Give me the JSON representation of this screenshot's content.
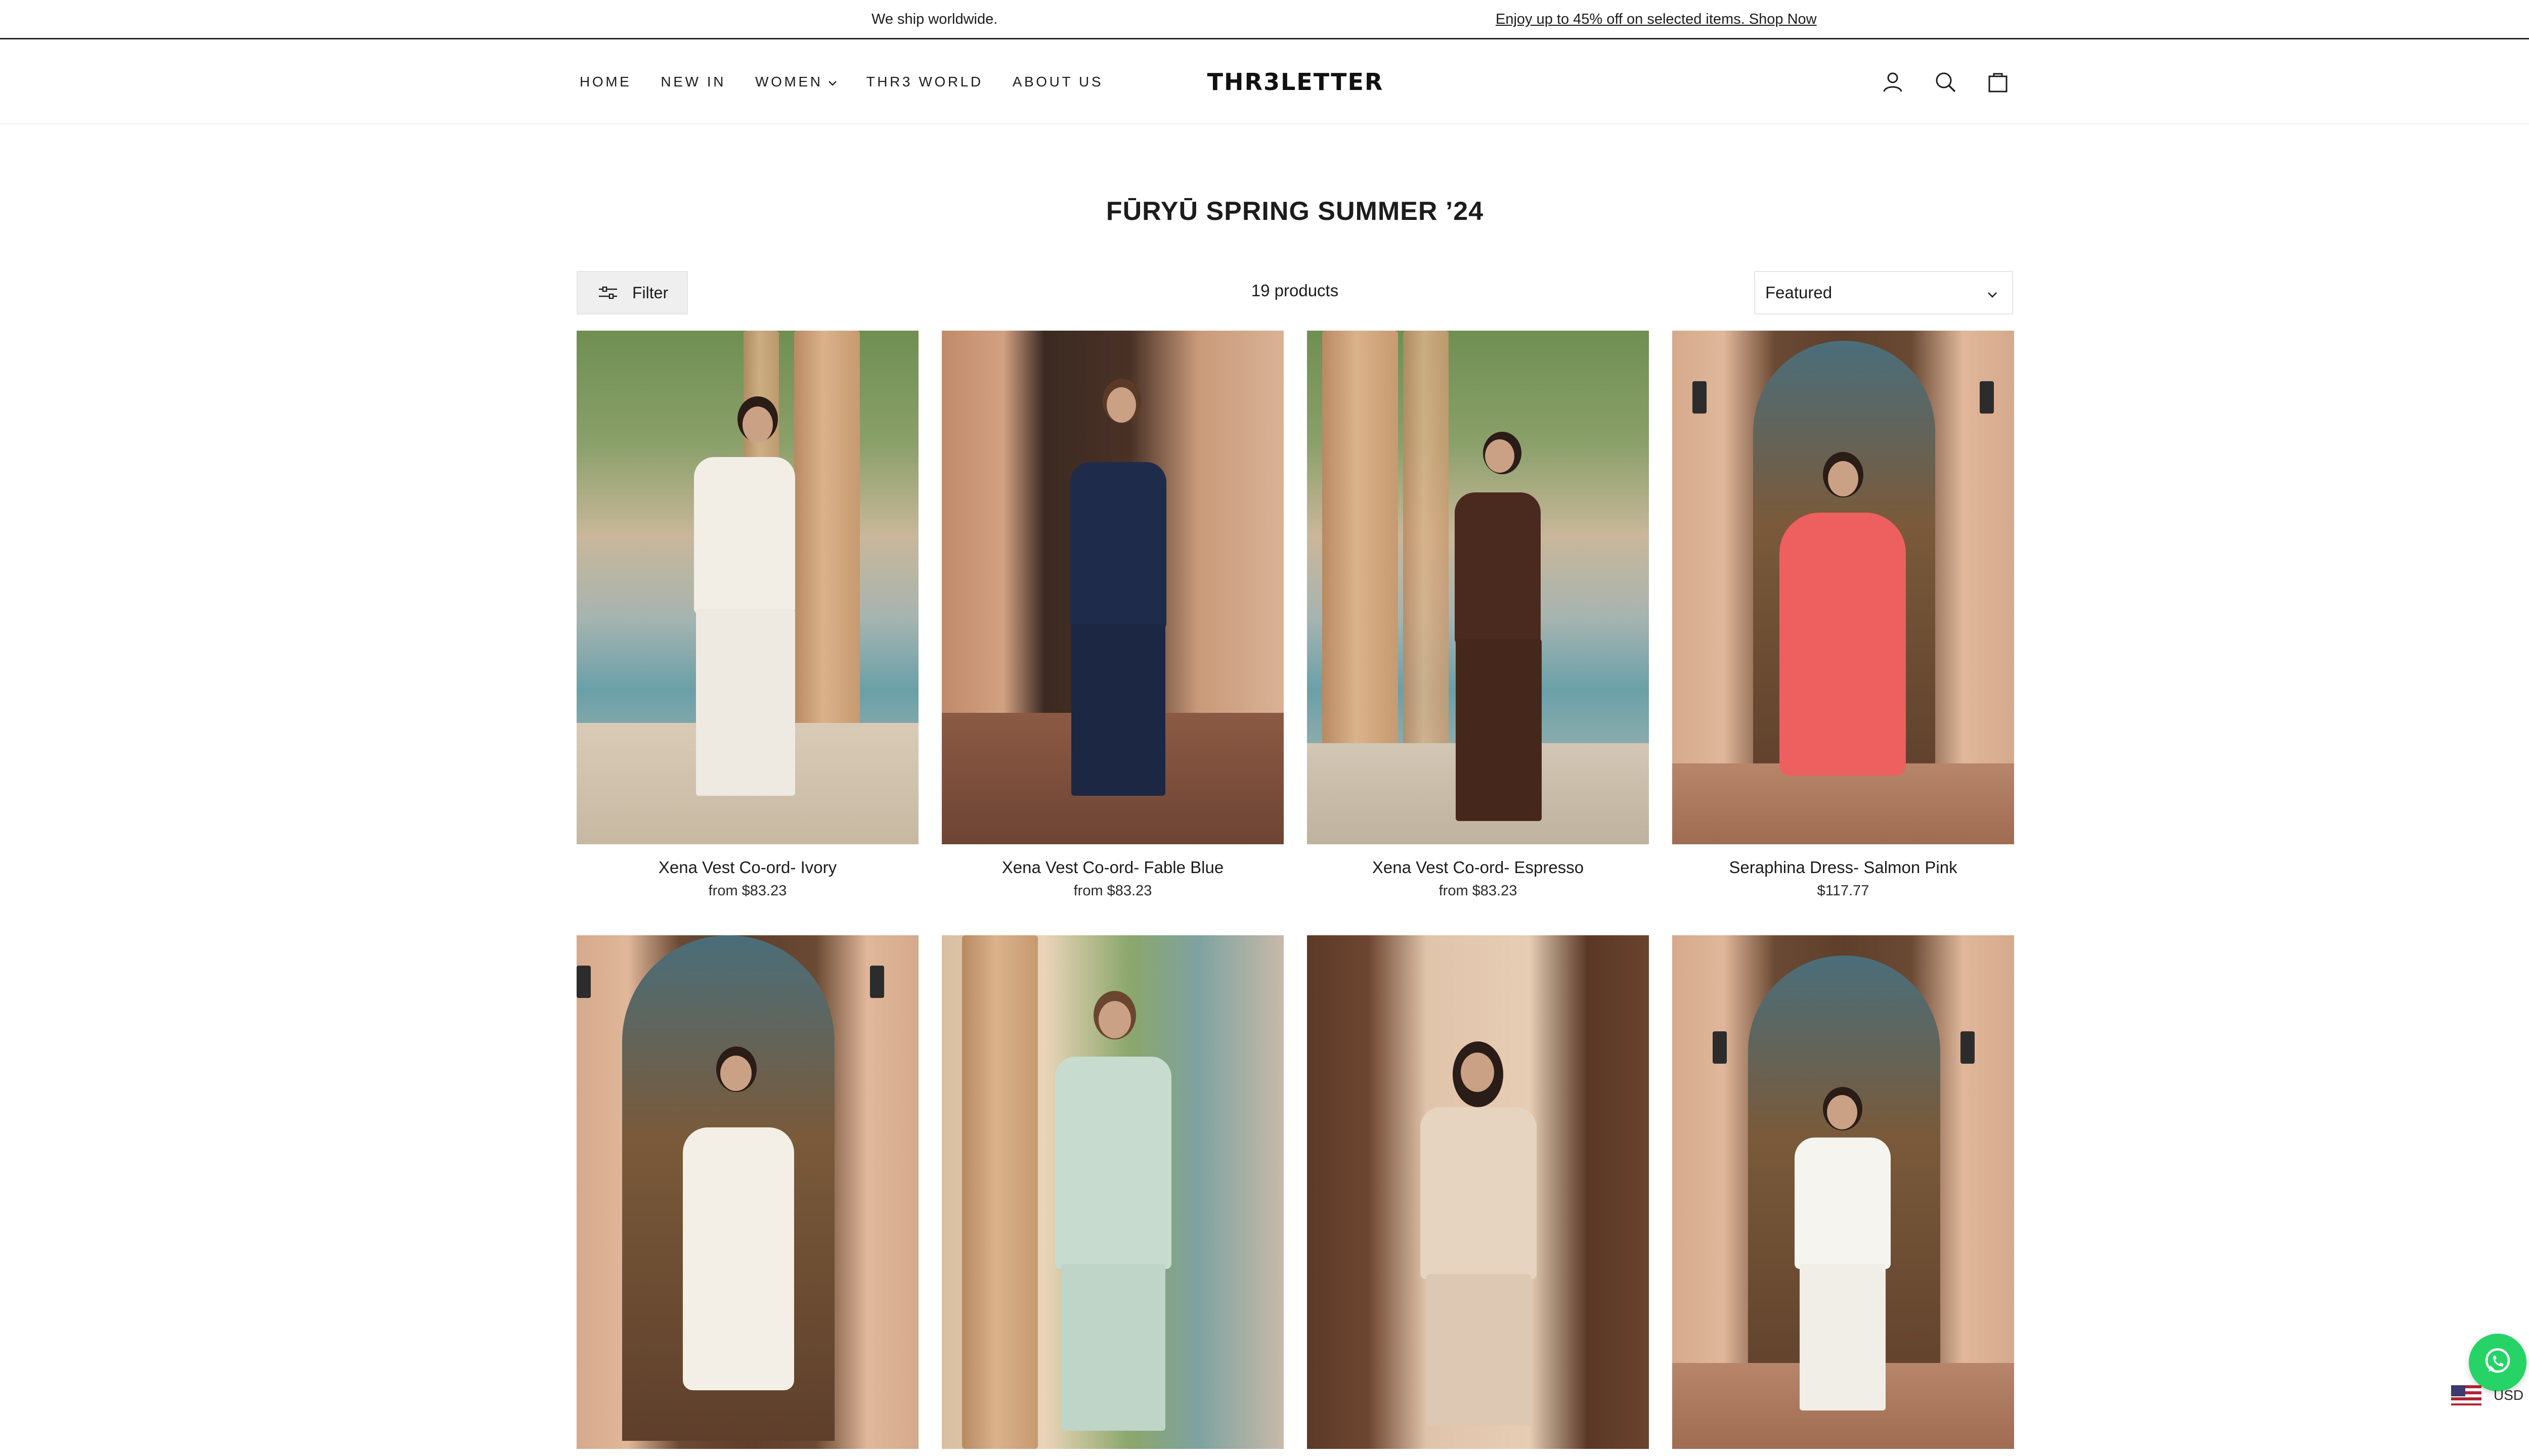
{
  "announcement": {
    "left": "We ship worldwide.",
    "right": "Enjoy up to 45% off on selected items. Shop Now"
  },
  "nav": {
    "items": [
      {
        "label": "HOME"
      },
      {
        "label": "NEW IN"
      },
      {
        "label": "WOMEN",
        "has_dropdown": true
      },
      {
        "label": "THR3 WORLD"
      },
      {
        "label": "ABOUT US"
      }
    ]
  },
  "brand": {
    "logo_text": "THR3LETTER"
  },
  "header_icons": [
    "account-icon",
    "search-icon",
    "cart-icon"
  ],
  "collection": {
    "title": "FŪRYŪ SPRING SUMMER ’24",
    "product_count": "19 products",
    "filter_label": "Filter",
    "sort_selected": "Featured"
  },
  "products": [
    {
      "name": "Xena Vest Co-ord- Ivory",
      "price": "from $83.23"
    },
    {
      "name": "Xena Vest Co-ord- Fable Blue",
      "price": "from $83.23"
    },
    {
      "name": "Xena Vest Co-ord- Espresso",
      "price": "from $83.23"
    },
    {
      "name": "Seraphina Dress- Salmon Pink",
      "price": "$117.77"
    },
    {
      "name": "",
      "price": ""
    },
    {
      "name": "",
      "price": ""
    },
    {
      "name": "",
      "price": ""
    },
    {
      "name": "",
      "price": ""
    }
  ],
  "currency": {
    "code": "USD"
  },
  "colors": {
    "text": "#1c1c1c",
    "border": "#e5e5e5",
    "whatsapp": "#25d366"
  }
}
